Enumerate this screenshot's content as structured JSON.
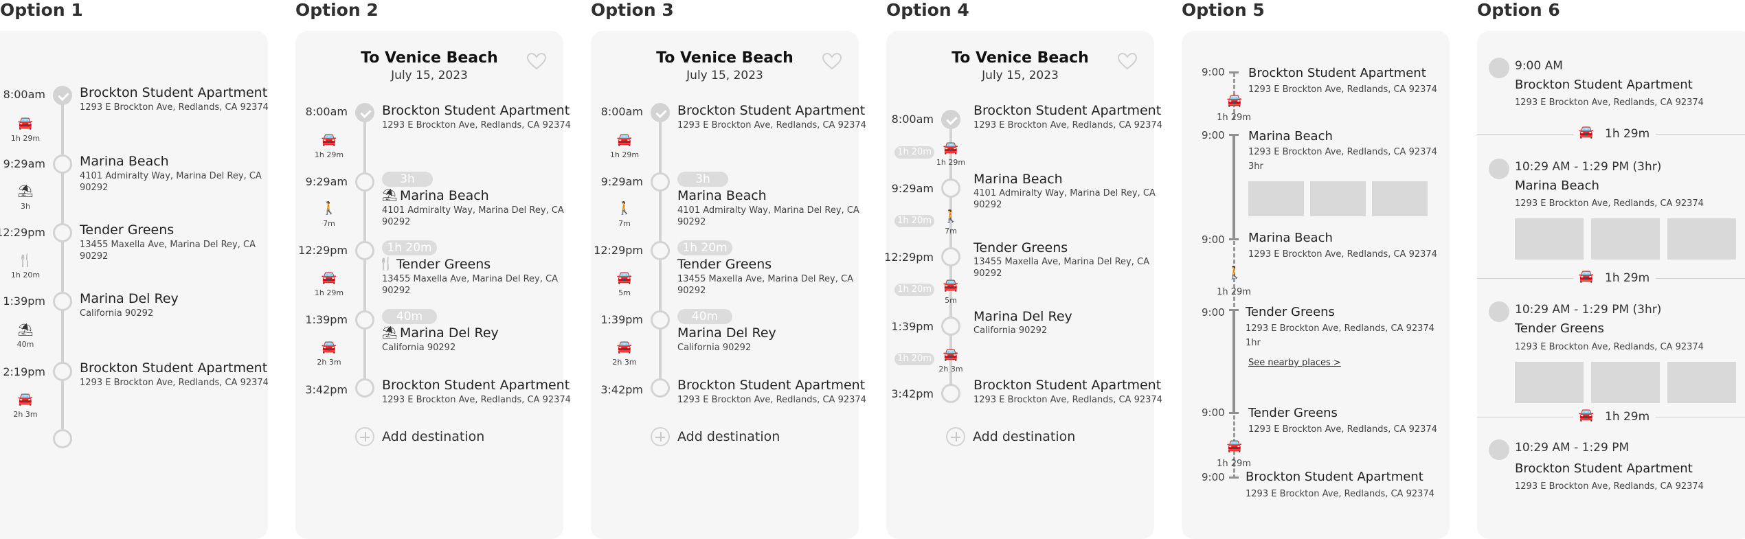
{
  "options": [
    "Option 1",
    "Option 2",
    "Option 3",
    "Option 4",
    "Option 5",
    "Option 6"
  ],
  "trip": {
    "title": "To Venice Beach",
    "date": "July 15, 2023",
    "add_label": "Add destination"
  },
  "places": {
    "brockton": {
      "name": "Brockton Student Apartment",
      "addr": "1293 E Brockton Ave, Redlands, CA 92374"
    },
    "marina_beach": {
      "name": "Marina Beach",
      "addr1": "4101 Admiralty Way, Marina Del Rey, CA",
      "addr2": "90292"
    },
    "tender": {
      "name": "Tender Greens",
      "addr1": "13455 Maxella Ave, Marina Del Rey, CA",
      "addr2": "90292"
    },
    "marina_del_rey": {
      "name": "Marina Del Rey",
      "addr": "California 90292"
    }
  },
  "times": {
    "t1": "8:00am",
    "t2": "9:29am",
    "t3": "12:29pm",
    "t4": "1:39pm",
    "t5": "2:19pm",
    "t6": "3:42pm"
  },
  "durations": {
    "d129": "1h 29m",
    "d3h": "3h",
    "d120": "1h 20m",
    "d40": "40m",
    "d7m": "7m",
    "d5m": "5m",
    "d23": "2h 3m"
  },
  "option5": {
    "time": "9:00",
    "stay": "3hr",
    "stay2": "1hr",
    "nearby": "See nearby places >"
  },
  "option6": {
    "times": [
      "9:00 AM",
      "10:29 AM - 1:29 PM (3hr)",
      "10:29 AM - 1:29 PM (3hr)",
      "10:29 AM - 1:29 PM"
    ],
    "names": [
      "Brockton Student Apartment",
      "Marina Beach",
      "Tender Greens",
      "Brockton Student Apartment"
    ],
    "addr": "1293 E Brockton Ave, Redlands, CA 92374",
    "drive": "1h 29m"
  },
  "icons": [
    "car-icon",
    "beach-umbrella-icon",
    "utensils-icon",
    "walk-icon",
    "heart-icon",
    "check-icon",
    "plus-icon"
  ]
}
